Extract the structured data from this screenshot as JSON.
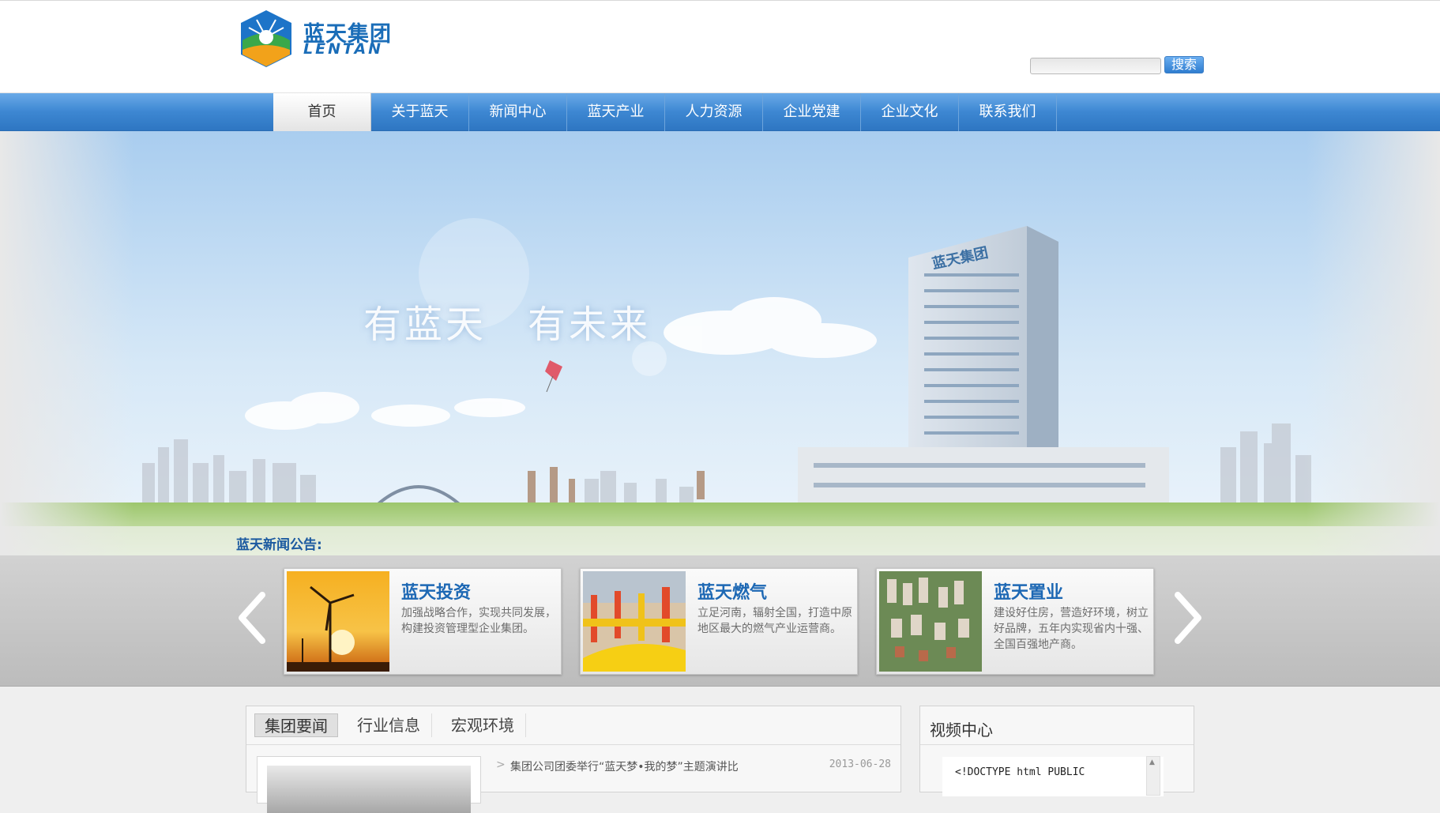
{
  "header": {
    "logo_cn": "蓝天集团",
    "logo_en": "LENTAN",
    "search_placeholder": "",
    "search_label": "搜索"
  },
  "nav": {
    "items": [
      {
        "label": "首页",
        "active": true
      },
      {
        "label": "关于蓝天"
      },
      {
        "label": "新闻中心"
      },
      {
        "label": "蓝天产业"
      },
      {
        "label": "人力资源"
      },
      {
        "label": "企业党建"
      },
      {
        "label": "企业文化"
      },
      {
        "label": "联系我们"
      }
    ]
  },
  "banner": {
    "slogan": "有蓝天　有未来",
    "building_sign": "蓝天集团",
    "news_label": "蓝天新闻公告:"
  },
  "products": [
    {
      "title": "蓝天投资",
      "desc": "加强战略合作，实现共同发展，构建投资管理型企业集团。"
    },
    {
      "title": "蓝天燃气",
      "desc": "立足河南，辐射全国，打造中原地区最大的燃气产业运营商。"
    },
    {
      "title": "蓝天置业",
      "desc": "建设好住房，营造好环境，树立好品牌，五年内实现省内十强、全国百强地产商。"
    }
  ],
  "news": {
    "tabs": [
      "集团要闻",
      "行业信息",
      "宏观环境"
    ],
    "items": [
      {
        "arrow": ">",
        "title": "集团公司团委举行“蓝天梦•我的梦”主题演讲比",
        "date": "2013-06-28"
      }
    ]
  },
  "video": {
    "title": "视频中心",
    "content": "<!DOCTYPE html PUBLIC"
  },
  "colors": {
    "brand_blue": "#1a6db8",
    "nav_blue": "#3d87d2"
  }
}
